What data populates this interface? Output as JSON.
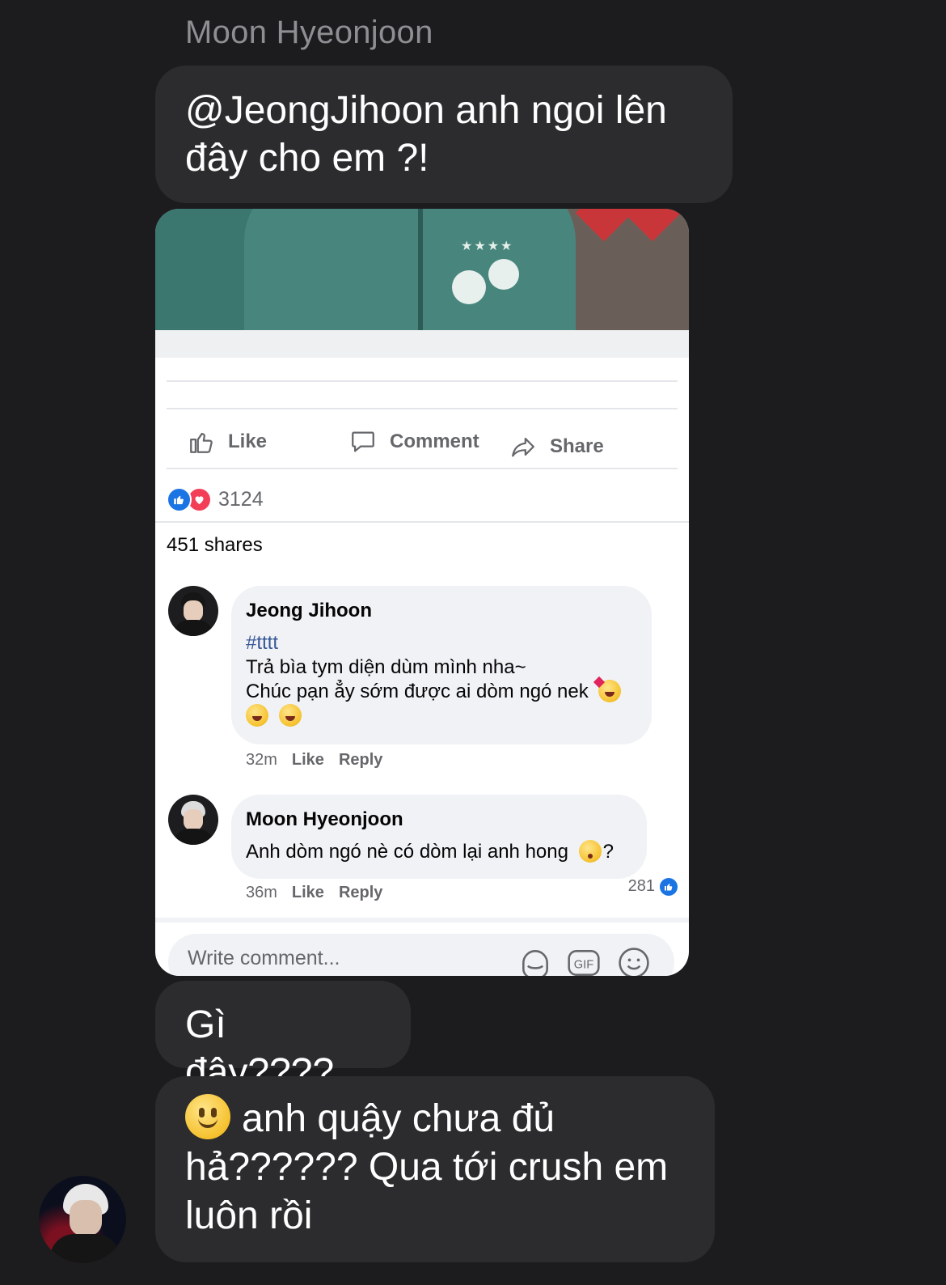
{
  "sender": {
    "name": "Moon Hyeonjoon"
  },
  "messages": [
    {
      "text": "@JeongJihoon anh ngoi lên đây cho em ?!"
    },
    {
      "text": "Gì đây????"
    },
    {
      "emoji": "slightly-smiling-face",
      "text": "anh quậy chưa đủ hả?????? Qua tới crush em luôn rồi"
    }
  ],
  "post": {
    "actions": {
      "like": "Like",
      "comment": "Comment",
      "share": "Share"
    },
    "reaction_count": "3124",
    "shares": "451 shares",
    "comments": [
      {
        "author": "Jeong Jihoon",
        "hashtag": "#tttt",
        "line1": "Trả bìa tym diện dùm mình nha~",
        "line2": "Chúc pạn ẳy sớm được ai dòm ngó nek",
        "time": "32m",
        "like": "Like",
        "reply": "Reply"
      },
      {
        "author": "Moon Hyeonjoon",
        "text": "Anh dòm ngó nè có dòm lại anh hong",
        "suffix": "?",
        "time": "36m",
        "like": "Like",
        "reply": "Reply",
        "likes": "281"
      }
    ],
    "composer_placeholder": "Write comment..."
  },
  "colors": {
    "background": "#1c1c1e",
    "bubble": "#2c2c2e",
    "fb_blue": "#1b74e4",
    "love": "#f33e58"
  }
}
